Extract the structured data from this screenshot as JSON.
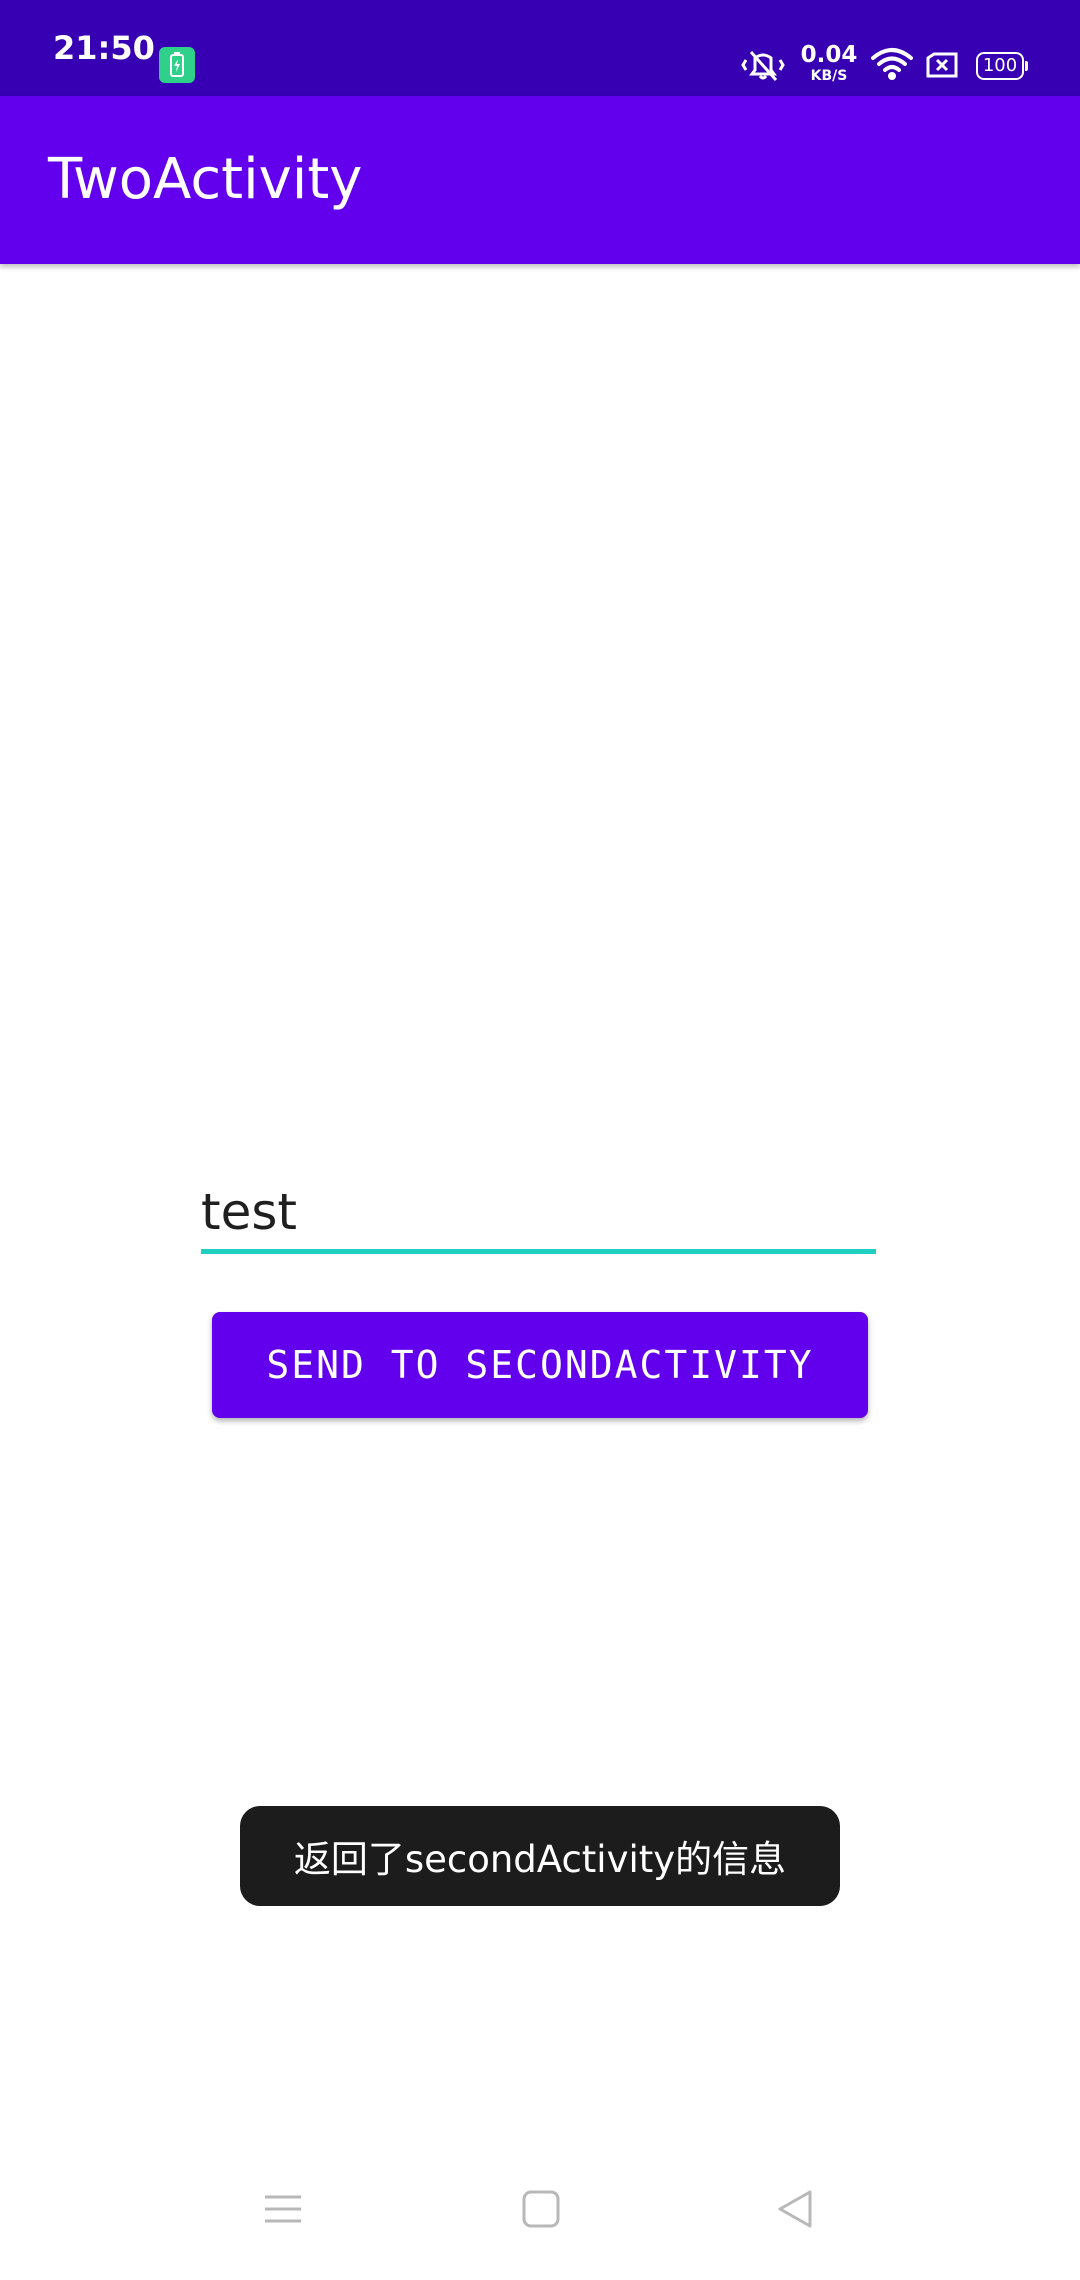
{
  "status_bar": {
    "time": "21:50",
    "network_speed_value": "0.04",
    "network_speed_unit": "KB/S",
    "battery_level": "100",
    "icons": [
      "battery-saver-icon",
      "vibrate-icon",
      "wifi-icon",
      "sim-icon",
      "battery-icon"
    ],
    "background_color": "#3700b3"
  },
  "app_bar": {
    "title": "TwoActivity",
    "background_color": "#6200ee"
  },
  "form": {
    "message_input_value": "test",
    "underline_color": "#1fcfc1",
    "send_button_label": "SEND TO SECONDACTIVITY",
    "button_color": "#6200ee"
  },
  "toast": {
    "message": "返回了secondActivity的信息"
  },
  "nav_bar": {
    "icons": [
      "menu-icon",
      "home-icon",
      "back-icon"
    ]
  }
}
